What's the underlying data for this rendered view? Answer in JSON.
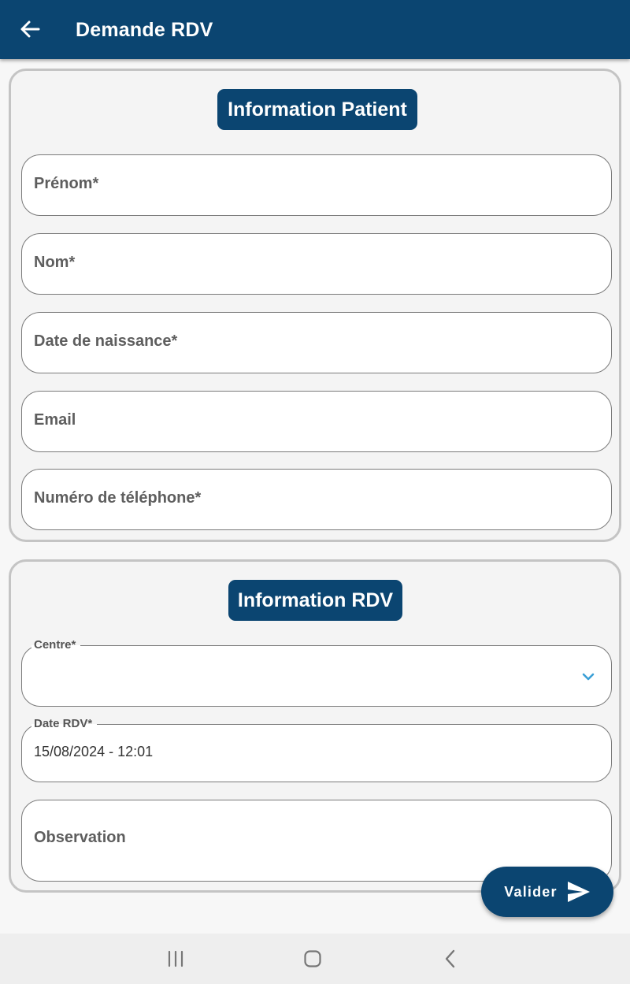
{
  "appbar": {
    "title": "Demande RDV",
    "back_icon": "arrow-left-icon",
    "background": "#0b4571"
  },
  "patient_section": {
    "heading": "Information Patient",
    "fields": {
      "first_name": "Prénom*",
      "last_name": "Nom*",
      "birth_date": "Date de naissance*",
      "email": "Email",
      "phone": "Numéro de téléphone*"
    }
  },
  "rdv_section": {
    "heading": "Information RDV",
    "centre": {
      "label": "Centre*",
      "value": "",
      "icon": "chevron-down-icon"
    },
    "date": {
      "label": "Date RDV*",
      "value": "15/08/2024 - 12:01"
    },
    "observation": {
      "placeholder": "Observation"
    }
  },
  "submit": {
    "label": "Valider",
    "icon": "send-icon"
  },
  "system_nav": {
    "recents_icon": "recents-icon",
    "home_icon": "home-icon",
    "back_icon": "nav-back-icon"
  },
  "colors": {
    "primary": "#0b4571",
    "accent": "#3a9fd6",
    "card_border": "#c4c4c4",
    "field_border": "#7a7a7a"
  }
}
